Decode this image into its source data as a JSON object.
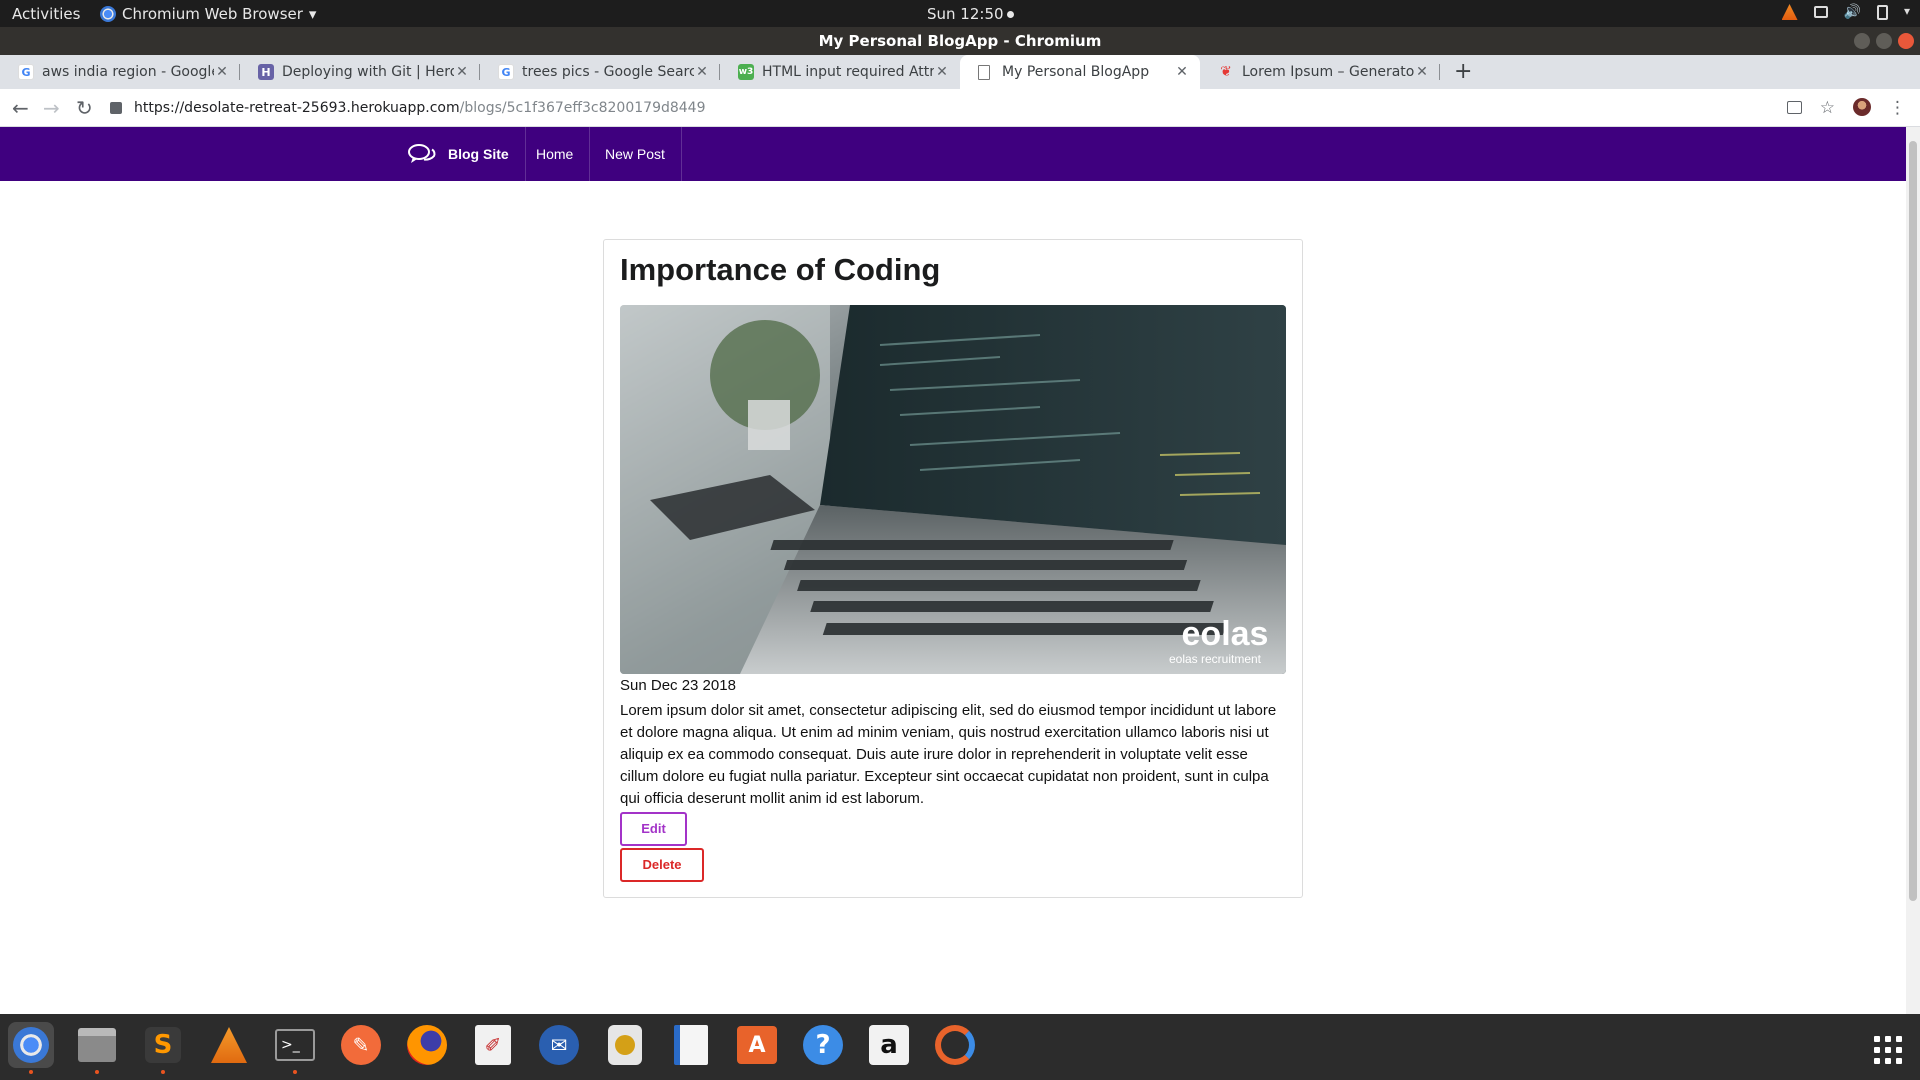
{
  "system_bar": {
    "activities": "Activities",
    "app_menu": "Chromium Web Browser",
    "clock": "Sun 12:50"
  },
  "window": {
    "title": "My Personal BlogApp - Chromium"
  },
  "tabs": [
    {
      "title": "aws india region - Google",
      "favicon": "google-icon"
    },
    {
      "title": "Deploying with Git | Heroku",
      "favicon": "heroku-icon"
    },
    {
      "title": "trees pics - Google Search",
      "favicon": "google-icon"
    },
    {
      "title": "HTML input required Attribute",
      "favicon": "w3schools-icon"
    },
    {
      "title": "My Personal BlogApp",
      "favicon": "page-icon",
      "active": true
    },
    {
      "title": "Lorem Ipsum – Generator",
      "favicon": "lipsum-icon"
    }
  ],
  "address_bar": {
    "host": "https://desolate-retreat-25693.herokuapp.com",
    "path": "/blogs/5c1f367eff3c8200179d8449"
  },
  "site_nav": {
    "brand": "Blog Site",
    "home": "Home",
    "new_post": "New Post"
  },
  "post": {
    "title": "Importance of Coding",
    "date": "Sun Dec 23 2018",
    "body": "Lorem ipsum dolor sit amet, consectetur adipiscing elit, sed do eiusmod tempor incididunt ut labore et dolore magna aliqua. Ut enim ad minim veniam, quis nostrud exercitation ullamco laboris nisi ut aliquip ex ea commodo consequat. Duis aute irure dolor in reprehenderit in voluptate velit esse cillum dolore eu fugiat nulla pariatur. Excepteur sint occaecat cupidatat non proident, sunt in culpa qui officia deserunt mollit anim id est laborum.",
    "image_logo": "eolas",
    "image_caption": "eolas recruitment",
    "edit_label": "Edit",
    "delete_label": "Delete"
  },
  "colors": {
    "nav_bg": "#3f007f",
    "edit": "#a333c8",
    "delete": "#db2828"
  },
  "dock": [
    "chromium-icon",
    "files-icon",
    "sublime-text-icon",
    "vlc-icon",
    "terminal-icon",
    "postman-icon",
    "firefox-icon",
    "document-viewer-icon",
    "thunderbird-icon",
    "rhythmbox-icon",
    "writer-icon",
    "software-center-icon",
    "help-icon",
    "amazon-icon",
    "update-icon"
  ]
}
